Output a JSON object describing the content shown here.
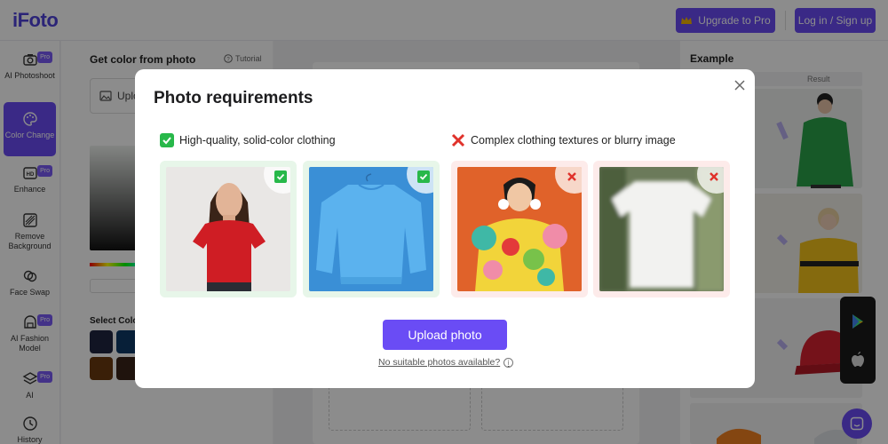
{
  "app": {
    "logo": "iFoto"
  },
  "header": {
    "upgrade_label": "Upgrade to Pro",
    "login_label": "Log in / Sign up"
  },
  "sidebar": {
    "items": [
      {
        "label": "AI Photoshoot",
        "icon": "camera-icon",
        "pro": true
      },
      {
        "label": "Color Change",
        "icon": "palette-icon",
        "pro": false,
        "active": true
      },
      {
        "label": "Enhance",
        "icon": "hd-icon",
        "pro": true
      },
      {
        "label": "Remove Background",
        "icon": "remove-bg-icon",
        "pro": false
      },
      {
        "label": "Face Swap",
        "icon": "face-swap-icon",
        "pro": false
      },
      {
        "label": "AI Fashion Model",
        "icon": "model-icon",
        "pro": true
      },
      {
        "label": "AI",
        "icon": "layers-icon",
        "pro": true
      },
      {
        "label": "History",
        "icon": "clock-icon",
        "pro": false
      }
    ],
    "pro_badge": "Pro"
  },
  "panel": {
    "title": "Get color from photo",
    "tutorial": "Tutorial",
    "upload_label": "Uplo",
    "select_label": "Select Colo",
    "swatch_colors": [
      "#1f2540",
      "#0e3a66",
      "#6b3a10",
      "#3a2418"
    ]
  },
  "example": {
    "title": "Example",
    "result_label": "Result"
  },
  "modal": {
    "title": "Photo requirements",
    "good_heading": "High-quality, solid-color clothing",
    "bad_heading": "Complex clothing textures or blurry image",
    "upload_button": "Upload photo",
    "no_suitable": "No suitable photos available?"
  },
  "colors": {
    "accent": "#6a4cf5",
    "good": "#28b84a",
    "bad": "#e0322b"
  }
}
